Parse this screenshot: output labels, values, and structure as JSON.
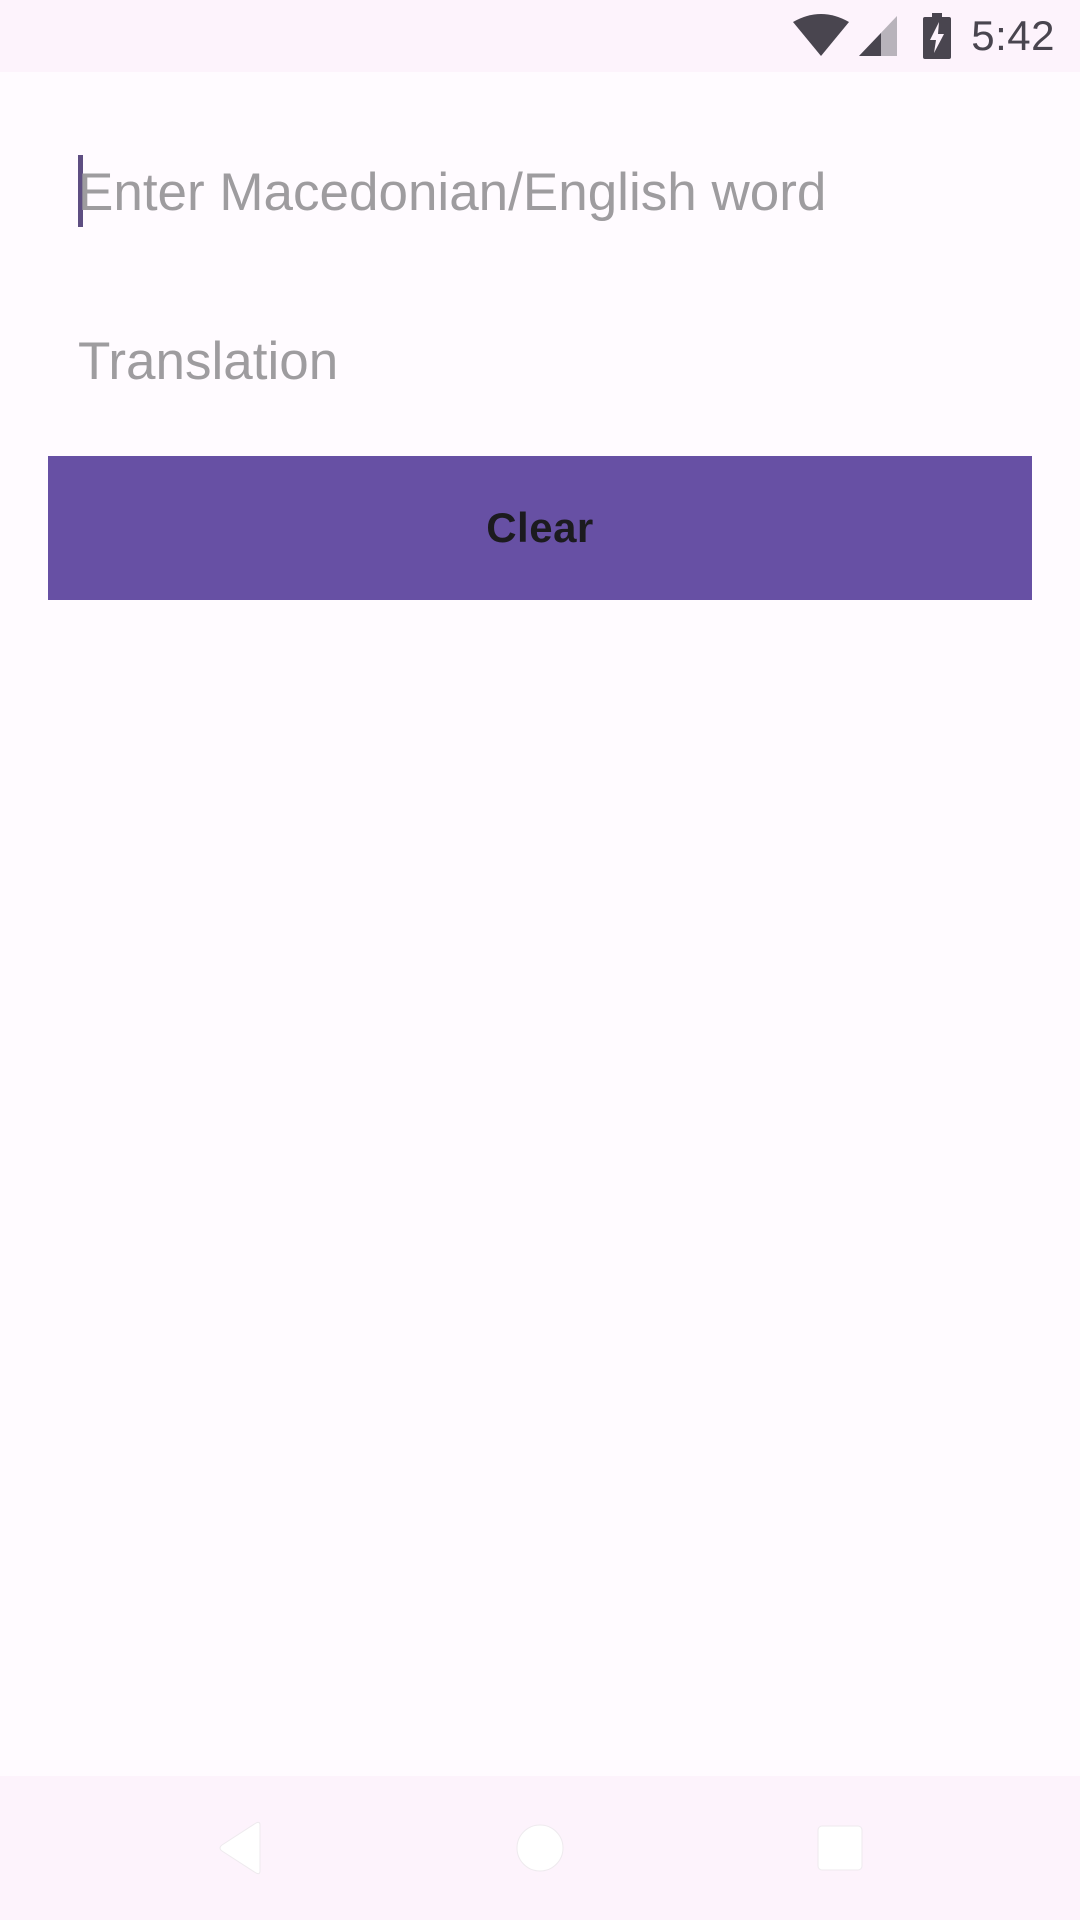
{
  "status_bar": {
    "time": "5:42",
    "icons": [
      "wifi-icon",
      "cell-signal-icon",
      "battery-charging-icon"
    ]
  },
  "form": {
    "input_placeholder": "Enter Macedonian/English word",
    "translation_placeholder": "Translation"
  },
  "actions": {
    "clear_label": "Clear"
  },
  "nav_bar": {
    "icons": [
      "back-icon",
      "home-icon",
      "recents-icon"
    ]
  },
  "colors": {
    "accent": "#6750A4",
    "background": "#FFFBFF",
    "system_bars": "#FDF3FC",
    "placeholder": "#9E9C9F"
  }
}
